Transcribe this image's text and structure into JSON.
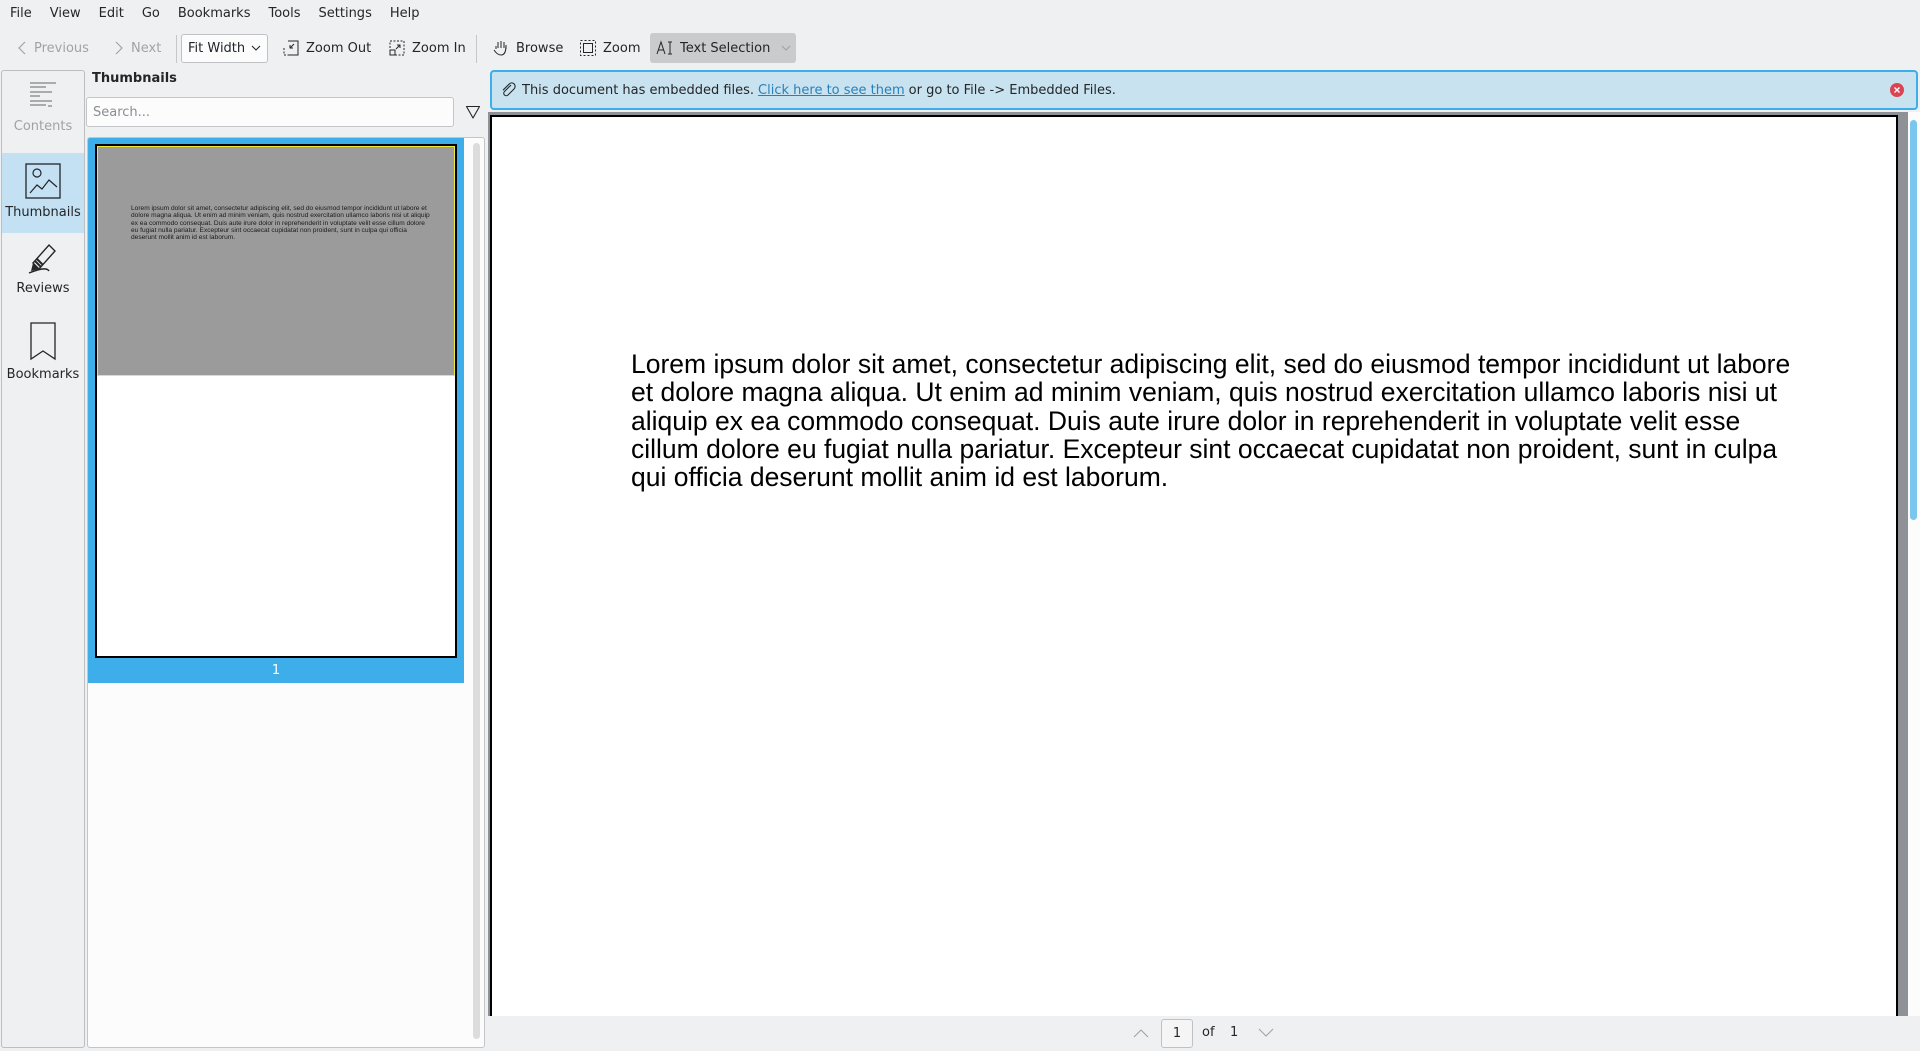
{
  "menu": [
    "File",
    "View",
    "Edit",
    "Go",
    "Bookmarks",
    "Tools",
    "Settings",
    "Help"
  ],
  "toolbar": {
    "previous_label": "Previous",
    "next_label": "Next",
    "zoom_mode": "Fit Width",
    "zoom_out_label": "Zoom Out",
    "zoom_in_label": "Zoom In",
    "browse_label": "Browse",
    "zoom_tool_label": "Zoom",
    "text_selection_label": "Text Selection"
  },
  "sidebar": {
    "items": [
      {
        "label": "Contents",
        "icon": "contents-icon",
        "state": "disabled"
      },
      {
        "label": "Thumbnails",
        "icon": "thumbnails-icon",
        "state": "selected"
      },
      {
        "label": "Reviews",
        "icon": "reviews-icon",
        "state": "normal"
      },
      {
        "label": "Bookmarks",
        "icon": "bookmarks-icon",
        "state": "normal"
      }
    ]
  },
  "thumbnails": {
    "title": "Thumbnails",
    "search_placeholder": "Search...",
    "search_value": "",
    "pages": [
      {
        "number": "1",
        "selected": true
      }
    ]
  },
  "banner": {
    "text_before": "This document has embedded files.",
    "link_text": "Click here to see them",
    "text_after": "or go to File -> Embedded Files."
  },
  "document": {
    "text": "Lorem ipsum dolor sit amet, consectetur adipiscing elit, sed do eiusmod tempor incididunt ut labore et dolore magna aliqua. Ut enim ad minim veniam, quis nostrud exercitation ullamco laboris nisi ut aliquip ex ea commodo consequat. Duis aute irure dolor in reprehenderit in voluptate velit esse cillum dolore eu fugiat nulla pariatur. Excepteur sint occaecat cupidatat non proident, sunt in culpa qui officia deserunt mollit anim id est laborum."
  },
  "pagination": {
    "current_page": "1",
    "of_label": "of",
    "total_pages": "1"
  },
  "colors": {
    "accent": "#3daee9",
    "banner_bg": "#c9e2ef",
    "link": "#2980b9",
    "close": "#da4453",
    "selected_sidebar": "#c4e0f3"
  }
}
